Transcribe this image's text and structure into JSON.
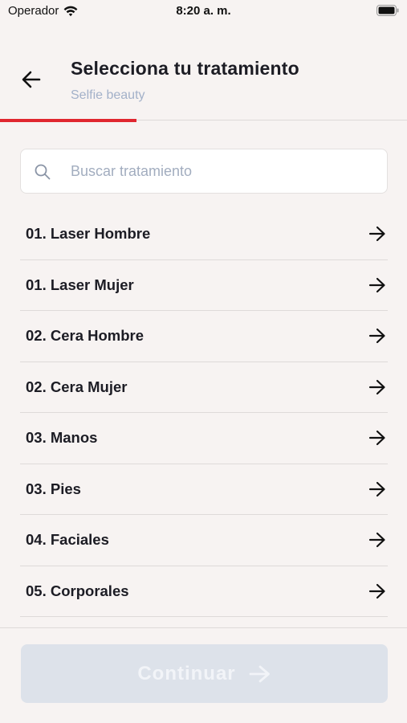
{
  "status_bar": {
    "carrier": "Operador",
    "time": "8:20 a. m."
  },
  "header": {
    "title": "Selecciona tu tratamiento",
    "subtitle": "Selfie beauty",
    "back_icon": "arrow-left-icon"
  },
  "progress": {
    "fraction": 0.335,
    "color": "#e0262f"
  },
  "search": {
    "placeholder": "Buscar tratamiento",
    "value": "",
    "icon": "search-icon"
  },
  "treatments": [
    {
      "label": "01. Laser Hombre"
    },
    {
      "label": "01. Laser Mujer"
    },
    {
      "label": "02. Cera Hombre"
    },
    {
      "label": "02. Cera Mujer"
    },
    {
      "label": "03. Manos"
    },
    {
      "label": "03. Pies"
    },
    {
      "label": "04. Faciales"
    },
    {
      "label": "05. Corporales"
    }
  ],
  "footer": {
    "continue_label": "Continuar",
    "continue_enabled": false
  },
  "colors": {
    "background": "#f7f3f2",
    "accent": "#e0262f",
    "subtitle": "#a3b1c9",
    "button_disabled": "#dde2ea"
  }
}
